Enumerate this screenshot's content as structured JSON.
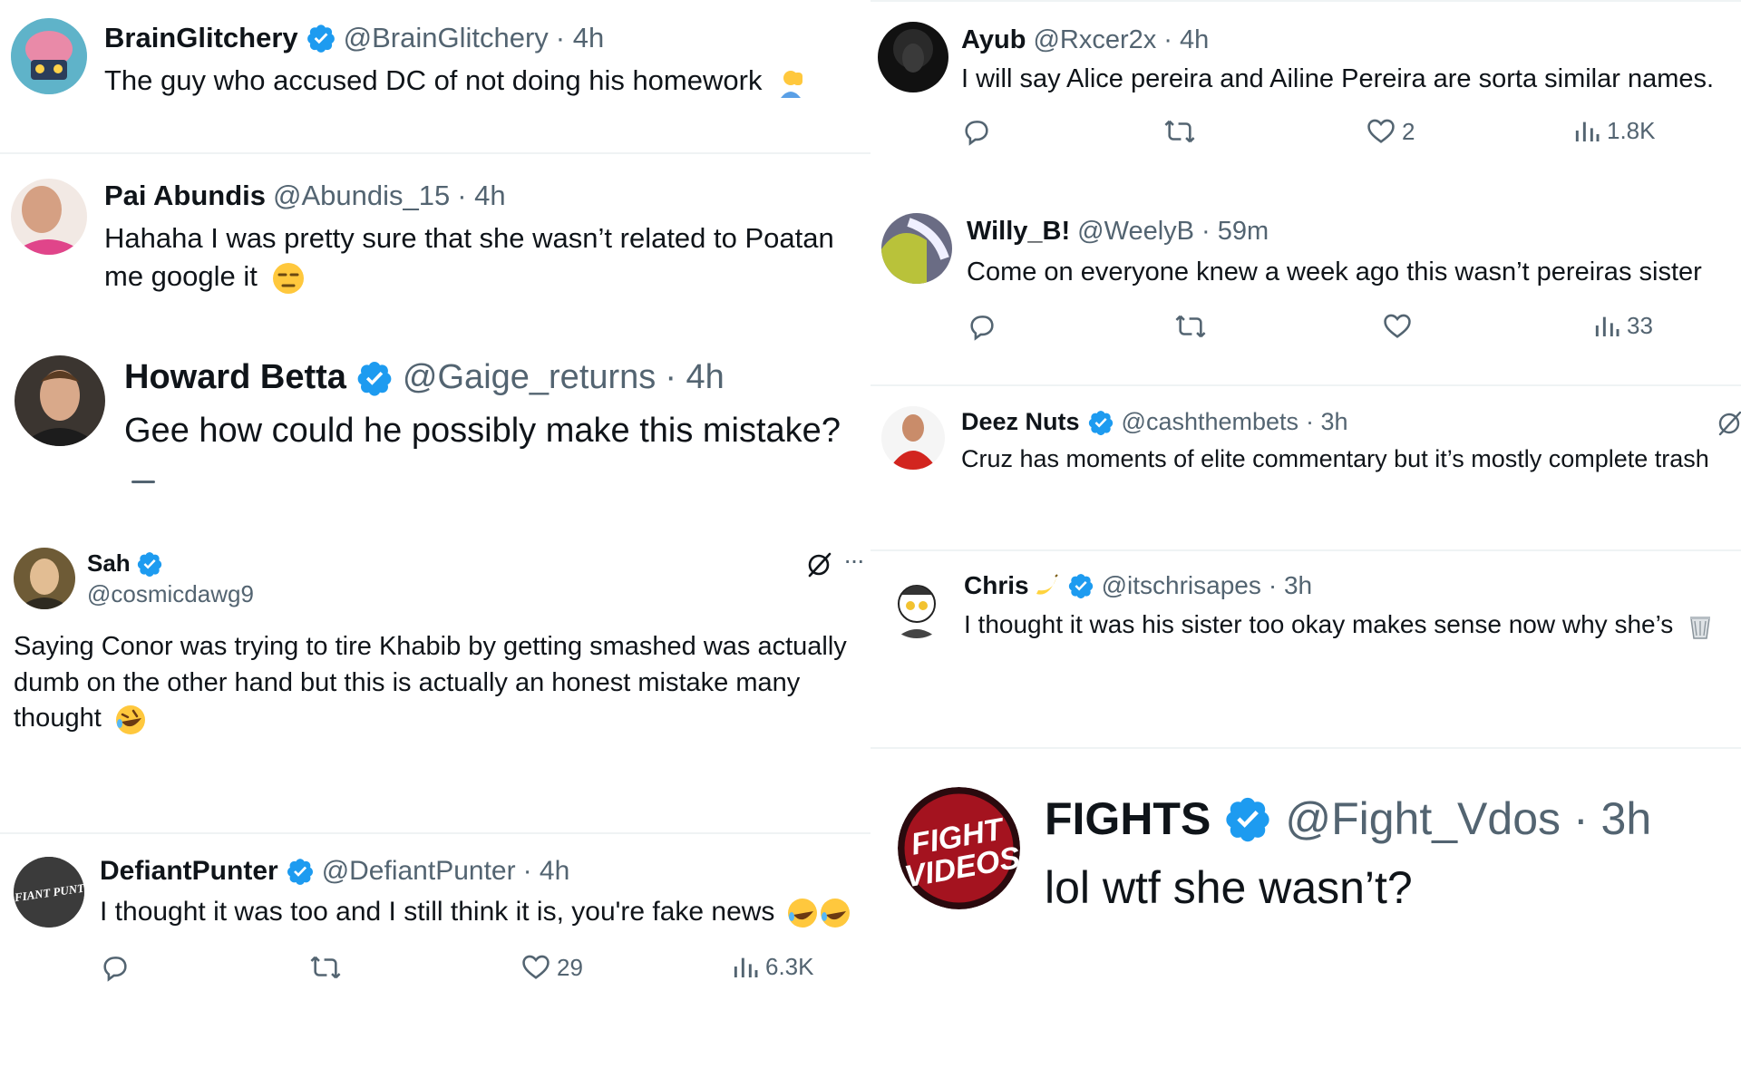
{
  "colors": {
    "verified": "#1d9bf0",
    "muted": "#536471",
    "text": "#0f1419",
    "divider": "#eff3f4"
  },
  "left": [
    {
      "id": "brainglitchery",
      "name": "BrainGlitchery",
      "verified": true,
      "handle": "@BrainGlitchery",
      "time": "· 4h",
      "text": "The guy who accused DC of not doing his homework",
      "emoji": "person-facepalming-emoji"
    },
    {
      "id": "paiabundis",
      "name": "Pai Abundis",
      "verified": false,
      "handle": "@Abundis_15",
      "time": "· 4h",
      "text_line1": "Hahaha I was pretty sure that she wasn’t related to Poatan",
      "text_line2": "me google it",
      "emoji": "unamused-face-emoji"
    },
    {
      "id": "howardbetta",
      "name": "Howard Betta",
      "verified": true,
      "handle": "@Gaige_returns",
      "time": "· 4h",
      "text": "Gee how could he possibly make this mistake?"
    },
    {
      "id": "sah",
      "name": "Sah",
      "verified": true,
      "handle": "@cosmicdawg9",
      "text_line1": "Saying Conor was trying to tire Khabib by getting smashed was actually",
      "text_line2": "dumb on the other hand but this is actually an honest mistake many",
      "text_line3": "thought",
      "emoji": "rolling-on-floor-laughing-emoji",
      "more": "···"
    },
    {
      "id": "defiantpunter",
      "name": "DefiantPunter",
      "verified": true,
      "handle": "@DefiantPunter",
      "time": "· 4h",
      "text": "I thought it was too and I still think it is, you're fake news",
      "avatar_text": "DEFIANT PUNTER",
      "likes": "29",
      "views": "6.3K"
    }
  ],
  "right": [
    {
      "id": "ayub",
      "name": "Ayub",
      "verified": false,
      "handle": "@Rxcer2x",
      "time": "· 4h",
      "text": "I will say Alice pereira and Ailine Pereira are sorta similar names.",
      "likes": "2",
      "views": "1.8K"
    },
    {
      "id": "willyb",
      "name": "Willy_B!",
      "verified": false,
      "handle": "@WeelyB",
      "time": "· 59m",
      "text": "Come on everyone knew a week ago this wasn’t pereiras sister",
      "views": "33"
    },
    {
      "id": "deeznuts",
      "name": "Deez Nuts",
      "verified": true,
      "handle": "@cashthembets",
      "time": "· 3h",
      "text": "Cruz has moments of elite commentary but it’s mostly complete trash"
    },
    {
      "id": "chris",
      "name": "Chris",
      "verified": true,
      "handle": "@itschrisapes",
      "time": "· 3h",
      "text": "I thought it was his sister too okay makes sense now why she’s",
      "emoji": "wastebasket-emoji"
    },
    {
      "id": "fights",
      "name": "FIGHTS",
      "verified": true,
      "handle": "@Fight_Vdos",
      "time": "· 3h",
      "text": "lol wtf she wasn’t?",
      "avatar_line1": "FIGHT",
      "avatar_line2": "VIDEOS"
    }
  ]
}
